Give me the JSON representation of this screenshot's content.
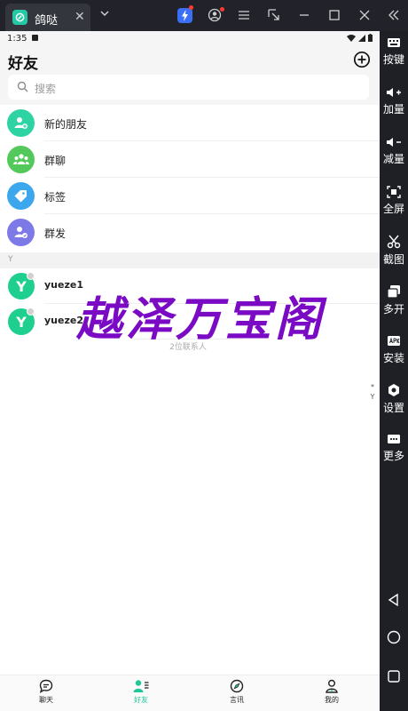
{
  "window": {
    "tab_title": "鸽哒",
    "tab_close": "✕"
  },
  "toolbar": {
    "items": [
      {
        "label": "按键",
        "icon": "keyboard-icon"
      },
      {
        "label": "加量",
        "icon": "volume-up-icon"
      },
      {
        "label": "减量",
        "icon": "volume-down-icon"
      },
      {
        "label": "全屏",
        "icon": "fullscreen-icon"
      },
      {
        "label": "截图",
        "icon": "scissors-icon"
      },
      {
        "label": "多开",
        "icon": "multi-instance-icon"
      },
      {
        "label": "安装",
        "icon": "apk-install-icon"
      },
      {
        "label": "设置",
        "icon": "gear-icon"
      },
      {
        "label": "更多",
        "icon": "more-icon"
      }
    ]
  },
  "status": {
    "time": "1:35"
  },
  "header": {
    "title": "好友"
  },
  "search": {
    "placeholder": "搜索"
  },
  "menu": {
    "items": [
      {
        "label": "新的朋友",
        "icon": "new-friend-icon",
        "color": "#2ed3a4"
      },
      {
        "label": "群聊",
        "icon": "group-chat-icon",
        "color": "#52c95a"
      },
      {
        "label": "标签",
        "icon": "tag-icon",
        "color": "#3da7ee"
      },
      {
        "label": "群发",
        "icon": "broadcast-icon",
        "color": "#7d79e6"
      }
    ]
  },
  "contacts": {
    "section_letter": "Y",
    "items": [
      {
        "initial": "Y",
        "name": "yueze1"
      },
      {
        "initial": "Y",
        "name": "yueze2"
      }
    ],
    "count_text": "2位联系人"
  },
  "index_bar": {
    "star": "*",
    "letter": "Y"
  },
  "watermark": {
    "text": "越泽万宝阁"
  },
  "bottom_nav": {
    "items": [
      {
        "label": "聊天",
        "icon": "chat-icon",
        "active": false
      },
      {
        "label": "好友",
        "icon": "friends-icon",
        "active": true
      },
      {
        "label": "言讯",
        "icon": "discover-icon",
        "active": false
      },
      {
        "label": "我的",
        "icon": "profile-icon",
        "active": false
      }
    ],
    "active_color": "#1fc798"
  }
}
